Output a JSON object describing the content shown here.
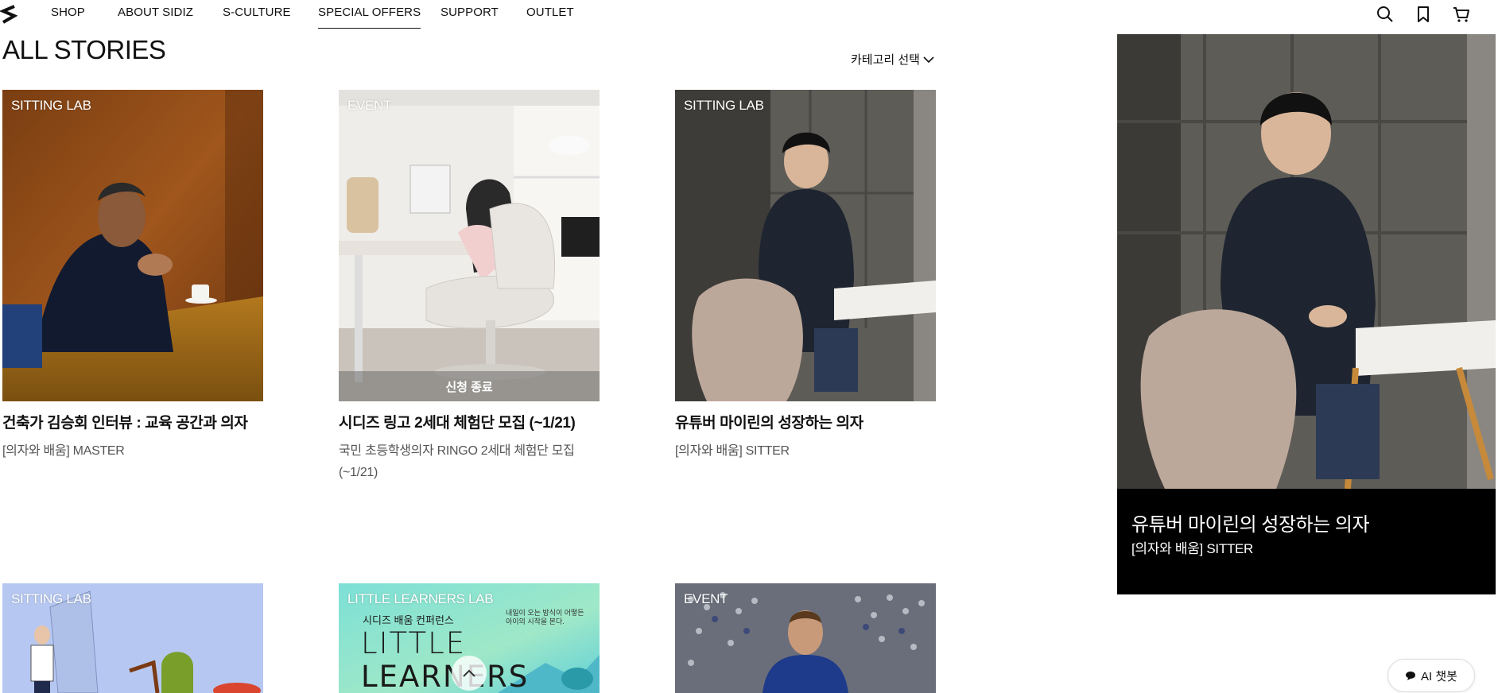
{
  "nav": {
    "items": [
      "SHOP",
      "ABOUT SIDIZ",
      "S-CULTURE",
      "SPECIAL OFFERS",
      "SUPPORT",
      "OUTLET"
    ],
    "active": "SPECIAL OFFERS",
    "icons": [
      "search-icon",
      "bookmark-icon",
      "cart-icon"
    ]
  },
  "page": {
    "title": "ALL STORIES",
    "category_label": "카테고리 선택"
  },
  "cards": [
    {
      "tag": "SITTING LAB",
      "title": "건축가 김승회 인터뷰 : 교육 공간과 의자",
      "sub": "[의자와 배움] MASTER"
    },
    {
      "tag": "EVENT",
      "title": "시디즈 링고 2세대 체험단 모집 (~1/21)",
      "sub": "국민 초등학생의자 RINGO 2세대 체험단 모집 (~1/21)",
      "overlay": "신청 종료"
    },
    {
      "tag": "SITTING LAB",
      "title": "유튜버 마이린의 성장하는 의자",
      "sub": "[의자와 배움] SITTER"
    },
    {
      "tag": "SITTING LAB"
    },
    {
      "tag": "LITTLE LEARNERS LAB",
      "poster_line1": "시디즈 배움 컨퍼런스",
      "poster_line2": "LITTLE",
      "poster_line3": "LEARNERS",
      "poster_note": "내일이 오는 방식이 어떻든\n아이의 시작을 본다."
    },
    {
      "tag": "EVENT"
    }
  ],
  "featured": {
    "title": "유튜버 마이린의 성장하는 의자",
    "sub": "[의자와 배움] SITTER"
  },
  "chatbot": {
    "label": "AI 챗봇"
  },
  "colors": {
    "featured_bg": "#000000",
    "text": "#111111",
    "sub": "#555555"
  }
}
